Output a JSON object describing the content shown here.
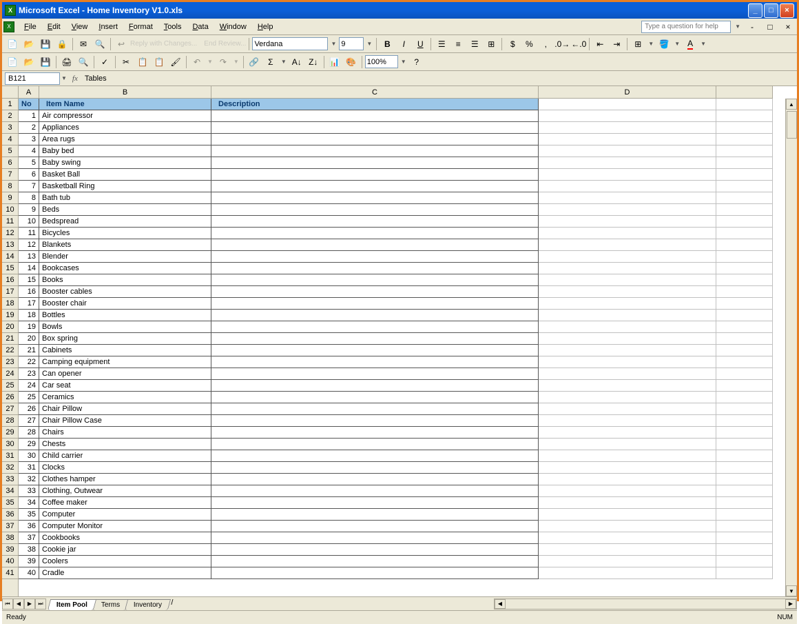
{
  "window": {
    "title": "Microsoft Excel - Home Inventory V1.0.xls"
  },
  "menus": [
    "File",
    "Edit",
    "View",
    "Insert",
    "Format",
    "Tools",
    "Data",
    "Window",
    "Help"
  ],
  "help_placeholder": "Type a question for help",
  "toolbar": {
    "font": "Verdana",
    "size": "9",
    "zoom": "100%"
  },
  "namebox": "B121",
  "formula": "Tables",
  "columns": [
    "A",
    "B",
    "C",
    "D",
    ""
  ],
  "headers": {
    "no": "No",
    "item": "Item Name",
    "desc": "Description"
  },
  "rows": [
    {
      "r": 1
    },
    {
      "r": 2,
      "no": 1,
      "item": "Air compressor"
    },
    {
      "r": 3,
      "no": 2,
      "item": "Appliances"
    },
    {
      "r": 4,
      "no": 3,
      "item": "Area rugs"
    },
    {
      "r": 5,
      "no": 4,
      "item": "Baby bed"
    },
    {
      "r": 6,
      "no": 5,
      "item": "Baby swing"
    },
    {
      "r": 7,
      "no": 6,
      "item": "Basket Ball"
    },
    {
      "r": 8,
      "no": 7,
      "item": "Basketball Ring"
    },
    {
      "r": 9,
      "no": 8,
      "item": "Bath tub"
    },
    {
      "r": 10,
      "no": 9,
      "item": "Beds"
    },
    {
      "r": 11,
      "no": 10,
      "item": "Bedspread"
    },
    {
      "r": 12,
      "no": 11,
      "item": "Bicycles"
    },
    {
      "r": 13,
      "no": 12,
      "item": "Blankets"
    },
    {
      "r": 14,
      "no": 13,
      "item": "Blender"
    },
    {
      "r": 15,
      "no": 14,
      "item": "Bookcases"
    },
    {
      "r": 16,
      "no": 15,
      "item": "Books"
    },
    {
      "r": 17,
      "no": 16,
      "item": "Booster cables"
    },
    {
      "r": 18,
      "no": 17,
      "item": "Booster chair"
    },
    {
      "r": 19,
      "no": 18,
      "item": "Bottles"
    },
    {
      "r": 20,
      "no": 19,
      "item": "Bowls"
    },
    {
      "r": 21,
      "no": 20,
      "item": "Box spring"
    },
    {
      "r": 22,
      "no": 21,
      "item": "Cabinets"
    },
    {
      "r": 23,
      "no": 22,
      "item": "Camping equipment"
    },
    {
      "r": 24,
      "no": 23,
      "item": "Can opener"
    },
    {
      "r": 25,
      "no": 24,
      "item": "Car seat"
    },
    {
      "r": 26,
      "no": 25,
      "item": "Ceramics"
    },
    {
      "r": 27,
      "no": 26,
      "item": "Chair Pillow"
    },
    {
      "r": 28,
      "no": 27,
      "item": "Chair Pillow Case"
    },
    {
      "r": 29,
      "no": 28,
      "item": "Chairs"
    },
    {
      "r": 30,
      "no": 29,
      "item": "Chests"
    },
    {
      "r": 31,
      "no": 30,
      "item": "Child carrier"
    },
    {
      "r": 32,
      "no": 31,
      "item": "Clocks"
    },
    {
      "r": 33,
      "no": 32,
      "item": "Clothes hamper"
    },
    {
      "r": 34,
      "no": 33,
      "item": "Clothing, Outwear"
    },
    {
      "r": 35,
      "no": 34,
      "item": "Coffee maker"
    },
    {
      "r": 36,
      "no": 35,
      "item": "Computer"
    },
    {
      "r": 37,
      "no": 36,
      "item": "Computer Monitor"
    },
    {
      "r": 38,
      "no": 37,
      "item": "Cookbooks"
    },
    {
      "r": 39,
      "no": 38,
      "item": "Cookie jar"
    },
    {
      "r": 40,
      "no": 39,
      "item": "Coolers"
    },
    {
      "r": 41,
      "no": 40,
      "item": "Cradle"
    }
  ],
  "sheets": [
    "Item Pool",
    "Terms",
    "Inventory"
  ],
  "status": {
    "left": "Ready",
    "right": "NUM"
  }
}
